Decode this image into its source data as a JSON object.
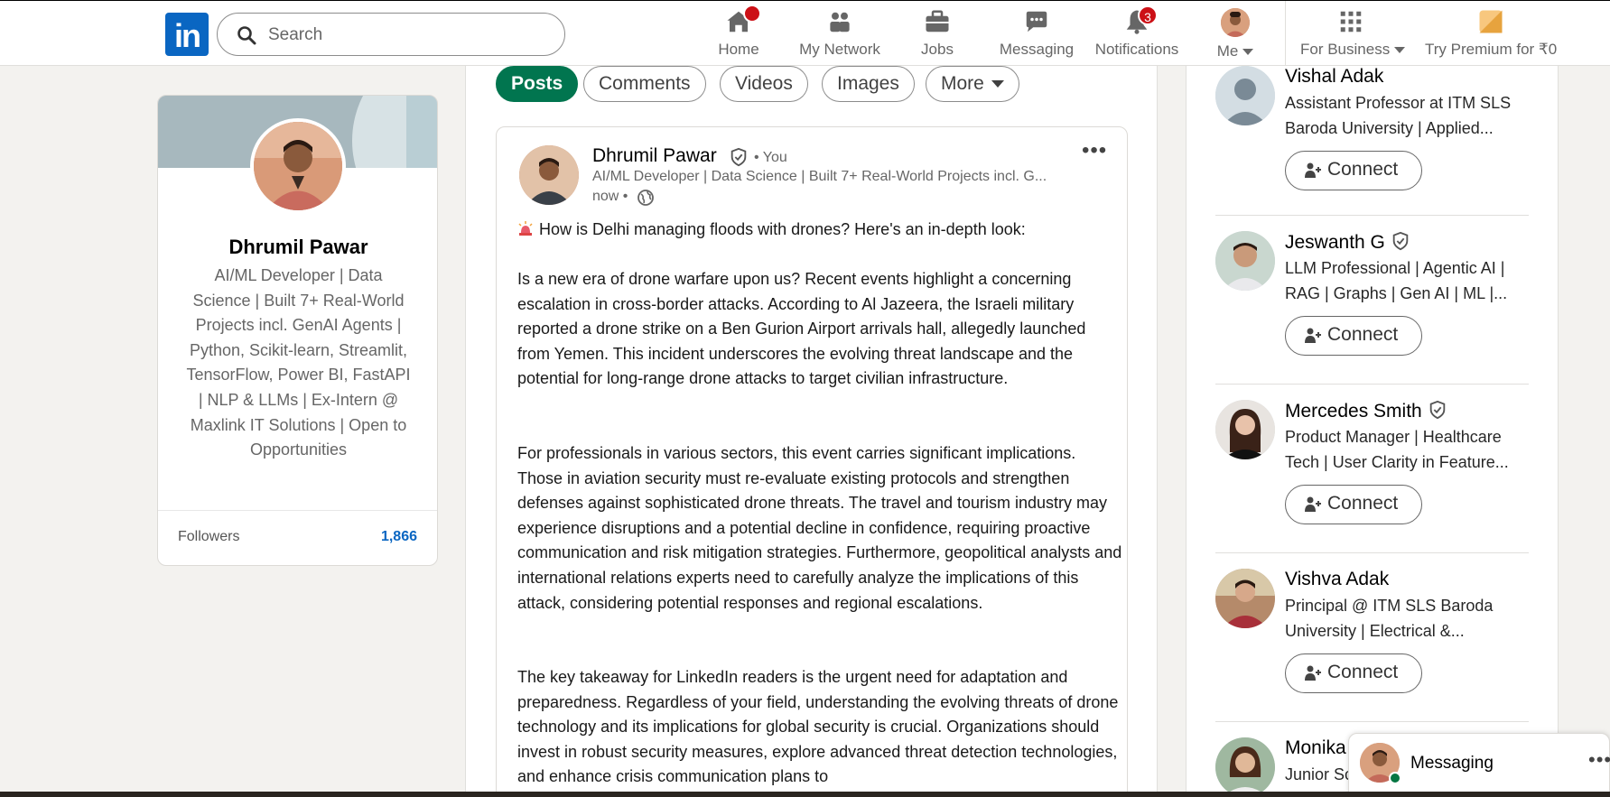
{
  "nav": {
    "search_placeholder": "Search",
    "items": [
      {
        "label": "Home",
        "icon": "home-icon",
        "badge": ""
      },
      {
        "label": "My Network",
        "icon": "network-icon",
        "badge": ""
      },
      {
        "label": "Jobs",
        "icon": "briefcase-icon",
        "badge": ""
      },
      {
        "label": "Messaging",
        "icon": "messaging-icon",
        "badge": ""
      },
      {
        "label": "Notifications",
        "icon": "bell-icon",
        "badge": "3"
      },
      {
        "label": "Me",
        "icon": "avatar",
        "badge": ""
      },
      {
        "label": "For Business",
        "icon": "grid-icon",
        "badge": ""
      },
      {
        "label": "Try Premium for ₹0",
        "icon": "premium-icon",
        "badge": ""
      }
    ],
    "accent": "#0a66c2",
    "badge_color": "#cc1016"
  },
  "profile": {
    "name": "Dhrumil Pawar",
    "headline": "AI/ML Developer | Data Science | Built 7+ Real-World Projects incl. GenAI Agents | Python, Scikit-learn, Streamlit, TensorFlow, Power BI, FastAPI | NLP & LLMs | Ex-Intern @ Maxlink IT Solutions | Open to Opportunities",
    "followers_label": "Followers",
    "followers_value": "1,866"
  },
  "tabs": {
    "items": [
      "Posts",
      "Comments",
      "Videos",
      "Images",
      "More"
    ],
    "active": "Posts",
    "active_color": "#01754f"
  },
  "post": {
    "author": "Dhrumil Pawar",
    "you_tag": "• You",
    "subtitle": "AI/ML Developer | Data Science | Built 7+ Real-World Projects incl. G...",
    "time": "now •",
    "paragraphs": [
      "How is Delhi managing floods with drones? Here's an in-depth look:",
      "Is a new era of drone warfare upon us? Recent events highlight a concerning escalation in cross-border attacks. According to Al Jazeera, the Israeli military reported a drone strike on a Ben Gurion Airport arrivals hall, allegedly launched from Yemen. This incident underscores the evolving threat landscape and the potential for long-range drone attacks to target civilian infrastructure.",
      "For professionals in various sectors, this event carries significant implications. Those in aviation security must re-evaluate existing protocols and strengthen defenses against sophisticated drone threats. The travel and tourism industry may experience disruptions and a potential decline in confidence, requiring proactive communication and risk mitigation strategies. Furthermore, geopolitical analysts and international relations experts need to carefully analyze the implications of this attack, considering potential responses and regional escalations.",
      "The key takeaway for LinkedIn readers is the urgent need for adaptation and preparedness. Regardless of your field, understanding the evolving threats of drone technology and its implications for global security is crucial. Organizations should invest in robust security measures, explore advanced threat detection technologies, and enhance crisis communication plans to"
    ]
  },
  "suggestions": [
    {
      "name": "Vishal Adak",
      "verified": false,
      "headline": "Assistant Professor at ITM SLS Baroda University | Applied...",
      "connect": "Connect"
    },
    {
      "name": "Jeswanth G",
      "verified": true,
      "headline": "LLM Professional | Agentic AI | RAG | Graphs | Gen AI | ML |...",
      "connect": "Connect"
    },
    {
      "name": "Mercedes Smith",
      "verified": true,
      "headline": "Product Manager | Healthcare Tech | User Clarity in Feature...",
      "connect": "Connect"
    },
    {
      "name": "Vishva Adak",
      "verified": false,
      "headline": "Principal @ ITM SLS Baroda University | Electrical &...",
      "connect": "Connect"
    },
    {
      "name": "Monika",
      "verified": false,
      "headline": "Junior Sc",
      "connect": ""
    }
  ],
  "messaging": {
    "label": "Messaging"
  }
}
